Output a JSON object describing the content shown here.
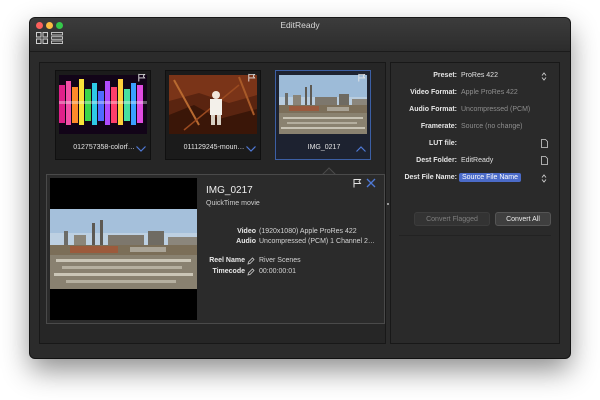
{
  "window": {
    "title": "EditReady"
  },
  "toolbar": {
    "grid_view_icon": "grid-view-icon",
    "list_view_icon": "list-view-icon"
  },
  "clips": [
    {
      "label": "012757358-colorf…",
      "flag_icon": "flag-icon",
      "chevron_icon": "chevron-down-icon",
      "selected": false
    },
    {
      "label": "011129245-moun…",
      "flag_icon": "flag-icon",
      "chevron_icon": "chevron-down-icon",
      "selected": false
    },
    {
      "label": "IMG_0217",
      "flag_icon": "flag-icon",
      "chevron_icon": "chevron-up-icon",
      "selected": true
    }
  ],
  "detail": {
    "title": "IMG_0217",
    "subtitle": "QuickTime movie",
    "video_label": "Video",
    "video_value": "(1920x1080) Apple ProRes 422",
    "audio_label": "Audio",
    "audio_value": "Uncompressed (PCM) 1 Channel 2…",
    "reel_label": "Reel Name",
    "reel_value": "River Scenes",
    "timecode_label": "Timecode",
    "timecode_value": "00:00:00:01"
  },
  "settings": {
    "preset_label": "Preset:",
    "preset_value": "ProRes 422",
    "video_format_label": "Video Format:",
    "video_format_value": "Apple ProRes 422",
    "audio_format_label": "Audio Format:",
    "audio_format_value": "Uncompressed (PCM)",
    "framerate_label": "Framerate:",
    "framerate_value": "Source (no change)",
    "lut_label": "LUT file:",
    "lut_value": "",
    "dest_folder_label": "Dest Folder:",
    "dest_folder_value": "EditReady",
    "dest_name_label": "Dest File Name:",
    "dest_name_value": "Source File Name",
    "convert_flagged": "Convert Flagged",
    "convert_all": "Convert All"
  },
  "colors": {
    "accent": "#4b6bc8",
    "selection_border": "#3c5fa4",
    "window_bg": "#2b2b2b"
  }
}
